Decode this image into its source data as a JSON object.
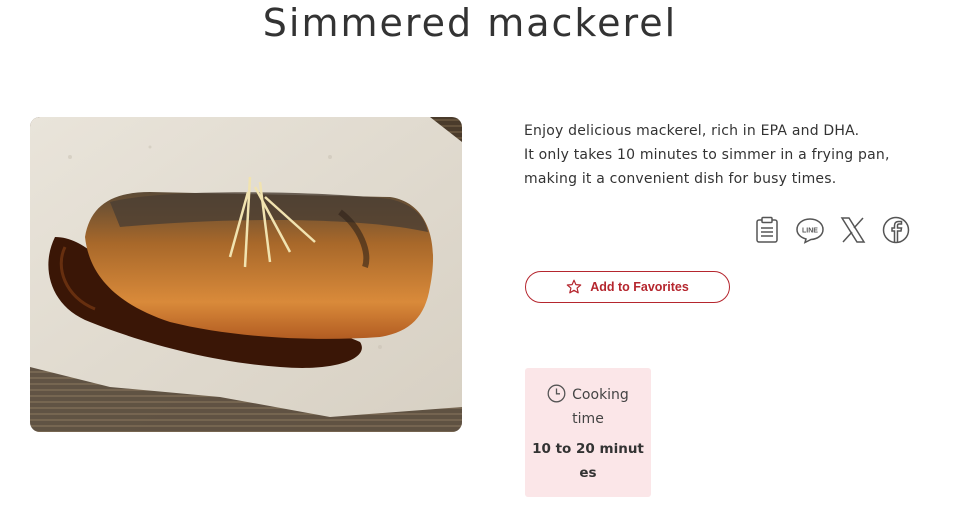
{
  "recipe": {
    "title": "Simmered mackerel",
    "description_lines": [
      "Enjoy delicious mackerel, rich in EPA and DHA.",
      "It only takes 10 minutes to simmer in a frying pan,",
      "making it a convenient dish for busy times."
    ],
    "photo_icon": "simmered-mackerel-photo"
  },
  "share": {
    "icons": [
      "clipboard-icon",
      "line-icon",
      "x-icon",
      "facebook-icon"
    ],
    "line_text": "LINE"
  },
  "favorites": {
    "label": "Add to Favorites",
    "icon": "star-icon",
    "color": "#b5262e"
  },
  "cooking": {
    "label_line1": "Cooking",
    "label_line2": "time",
    "value": "10 to 20 minutes",
    "icon": "clock-icon",
    "background": "#fbe6e8"
  }
}
